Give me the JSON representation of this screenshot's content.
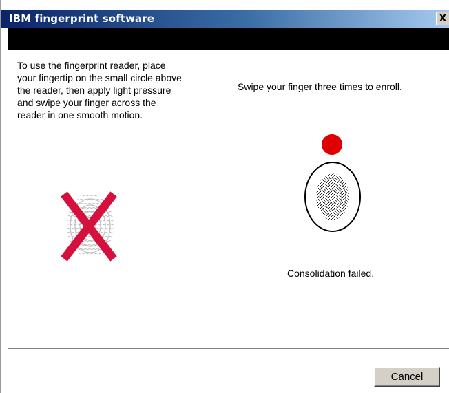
{
  "window": {
    "title": "IBM fingerprint software",
    "close_label": "X"
  },
  "instructions": {
    "text": "To use the fingerprint reader, place your fingertip on the small circle above the reader, then apply light pressure and swipe your finger across the reader in one smooth motion."
  },
  "enroll": {
    "prompt": "Swipe your finger three times to enroll.",
    "status": "Consolidation failed.",
    "indicator_color": "#e00000"
  },
  "icons": {
    "error_mark": "fingerprint-error-x-icon",
    "sensor": "fingerprint-sensor-icon",
    "indicator": "red-indicator-dot"
  },
  "footer": {
    "cancel_label": "Cancel"
  }
}
